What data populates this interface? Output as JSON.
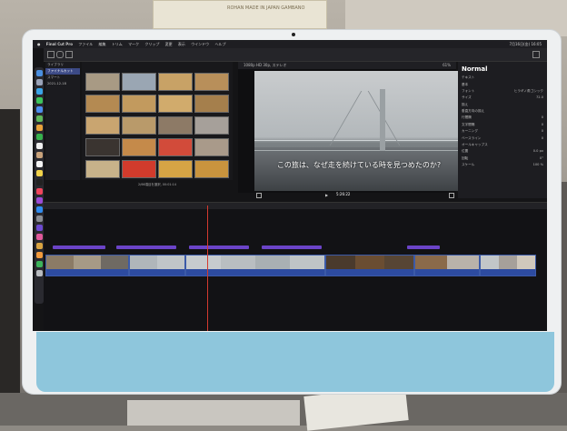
{
  "environment": {
    "box_label": "ROHAN  MADE IN JAPAN  GAMBANO"
  },
  "menubar": {
    "app_name": "Final Cut Pro",
    "items": [
      "ファイル",
      "編集",
      "トリム",
      "マーク",
      "クリップ",
      "変更",
      "表示",
      "ウインドウ",
      "ヘルプ"
    ],
    "right_text": "7月16日(金) 16:05"
  },
  "sidebar": {
    "items": [
      "ライブラリ",
      "ファイナルカット",
      "スマート",
      "2021-12-18"
    ]
  },
  "browser": {
    "footer": "2/66項目を選択, 00:01:14"
  },
  "viewer": {
    "header": "1080p HD 30p, ステレオ",
    "subtitle": "この旅は、なぜ走を続けている時を見つめたのか?",
    "timecode": "5:26:22",
    "zoom": "61%"
  },
  "inspector": {
    "title": "Normal",
    "rows": [
      {
        "label": "テキスト",
        "value": ""
      },
      {
        "label": "基本",
        "value": ""
      },
      {
        "label": "フォント",
        "value": "ヒラギノ角ゴシック"
      },
      {
        "label": "サイズ",
        "value": "72.0"
      },
      {
        "label": "揃え",
        "value": ""
      },
      {
        "label": "垂直方向の揃え",
        "value": ""
      },
      {
        "label": "行間隔",
        "value": "0"
      },
      {
        "label": "文字間隔",
        "value": "0"
      },
      {
        "label": "カーニング",
        "value": "0"
      },
      {
        "label": "ベースライン",
        "value": "0"
      },
      {
        "label": "オールキャップス",
        "value": ""
      },
      {
        "label": "位置",
        "value": "0.0 px"
      },
      {
        "label": "回転",
        "value": "0°"
      },
      {
        "label": "スケール",
        "value": "100 %"
      }
    ]
  },
  "timeline": {
    "bar_text": "インデックス"
  },
  "colors": {
    "playhead": "#d43a2f",
    "title_clip": "#6b44c8",
    "video_clip": "#2a3e7a",
    "chin": "#8ec6dc"
  }
}
